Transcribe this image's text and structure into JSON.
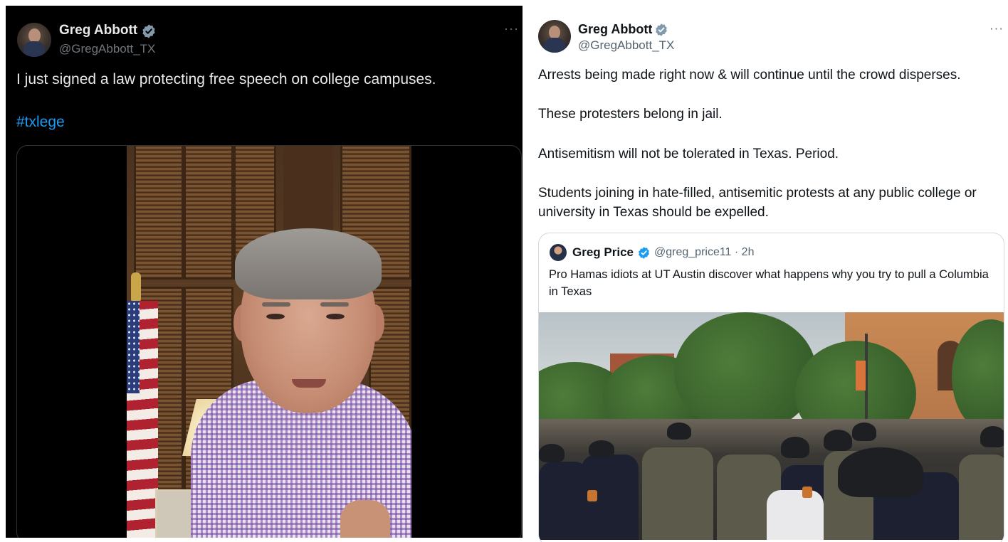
{
  "left_tweet": {
    "author_name": "Greg Abbott",
    "handle": "@GregAbbott_TX",
    "more_label": "···",
    "text": "I just signed a law protecting free speech on college campuses.",
    "hashtag": "#txlege",
    "verified_icon": "verified-badge-icon",
    "colors": {
      "background": "#000000",
      "text": "#e7e9ea",
      "link": "#1d9bf0",
      "muted": "#71767b"
    }
  },
  "right_tweet": {
    "author_name": "Greg Abbott",
    "handle": "@GregAbbott_TX",
    "more_label": "···",
    "paragraphs": [
      "Arrests being made right now & will continue until the crowd disperses.",
      "These protesters belong in jail.",
      "Antisemitism will not be tolerated in Texas. Period.",
      "Students joining in hate-filled, antisemitic protests at any public college or university in Texas should be expelled."
    ],
    "verified_icon": "verified-badge-icon",
    "quoted": {
      "author_name": "Greg Price",
      "handle_time": "@greg_price11 · 2h",
      "text": "Pro Hamas idiots at UT Austin discover what happens why you try to pull a Columbia in Texas",
      "verified_icon": "verified-badge-icon"
    },
    "colors": {
      "background": "#ffffff",
      "text": "#0f1419",
      "muted": "#536471",
      "border": "#cfd9de",
      "verified": "#1d9bf0"
    }
  }
}
